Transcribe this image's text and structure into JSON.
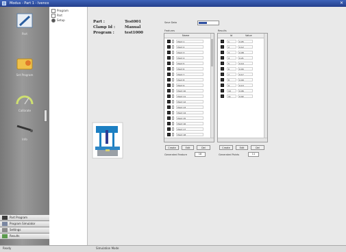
{
  "window": {
    "title": "Modus - Part 1 - Ivenco"
  },
  "sidebar": {
    "items": [
      {
        "label": "Part",
        "icon": "pen-icon"
      },
      {
        "label": "Set Program",
        "icon": "folder-icon"
      },
      {
        "label": "Calibrate",
        "icon": "gauge-icon"
      },
      {
        "label": "Info",
        "icon": "probe-icon"
      }
    ],
    "bottom": [
      {
        "label": "Part Program",
        "icon": "program-icon"
      },
      {
        "label": "Program Simulator",
        "icon": "simulator-icon"
      },
      {
        "label": "Settings",
        "icon": "settings-icon"
      },
      {
        "label": "Results",
        "icon": "results-icon"
      }
    ]
  },
  "tree": {
    "items": [
      "Program",
      "Part",
      "Setup"
    ]
  },
  "info": {
    "part_label": "Part :",
    "part_value": "Test001",
    "clamp_label": "Clamp Id :",
    "clamp_value": "Manual",
    "program_label": "Program :",
    "program_value": "test1000"
  },
  "top_field": {
    "label": "Save Data"
  },
  "left_list": {
    "title": "Features",
    "header": "Name",
    "rows": [
      "Point 1",
      "Point 2",
      "Point 3",
      "Point 4",
      "Point 5",
      "Point 6",
      "Point 7",
      "Point 8",
      "Point 9",
      "Point 10",
      "Point 11",
      "Point 12",
      "Point 13",
      "Point 14",
      "Point 15",
      "Point 16",
      "Point 17",
      "Point 18"
    ],
    "buttons": [
      "Create",
      "Edit",
      "Del"
    ],
    "footer_label": "Generated Feature",
    "footer_value": "18"
  },
  "right_list": {
    "title": "Results",
    "headers": [
      "Id",
      "Value"
    ],
    "rows": [
      [
        "1",
        "0.05"
      ],
      [
        "2",
        "0.12"
      ],
      [
        "3",
        "0.08"
      ],
      [
        "4",
        "0.21"
      ],
      [
        "5",
        "0.10"
      ],
      [
        "6",
        "0.04"
      ],
      [
        "7",
        "0.17"
      ],
      [
        "8",
        "0.09"
      ],
      [
        "9",
        "0.13"
      ],
      [
        "10",
        "0.06"
      ],
      [
        "11",
        "0.02"
      ]
    ],
    "buttons": [
      "Create",
      "Edit",
      "Del"
    ],
    "footer_label": "Generated Points",
    "footer_value": "11"
  },
  "statusbar": {
    "left": "Ready",
    "center": "Simulation Mode"
  }
}
